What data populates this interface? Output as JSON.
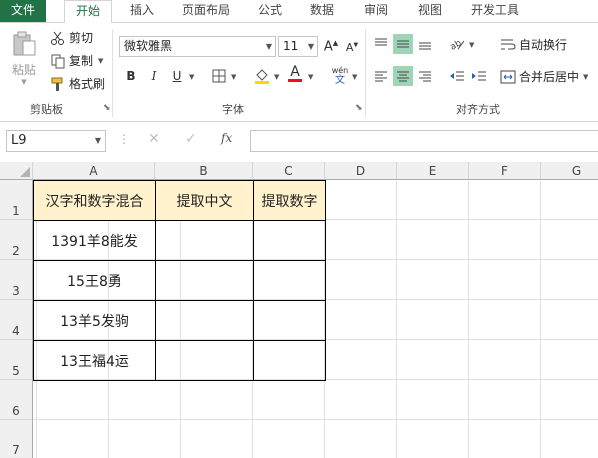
{
  "tabs": [
    "文件",
    "开始",
    "插入",
    "页面布局",
    "公式",
    "数据",
    "审阅",
    "视图",
    "开发工具"
  ],
  "clipboard": {
    "paste_label": "粘贴",
    "cut_label": "剪切",
    "copy_label": "复制",
    "format_painter_label": "格式刷",
    "group_label": "剪贴板"
  },
  "font": {
    "name": "微软雅黑",
    "size": "11",
    "bold": "B",
    "italic": "I",
    "underline": "U",
    "wen_top": "wén",
    "wen_bottom": "文",
    "group_label": "字体",
    "font_color": "#e81123",
    "fill_color": "#ffd700"
  },
  "alignment": {
    "wrap_text_label": "自动换行",
    "merge_center_label": "合并后居中",
    "group_label": "对齐方式"
  },
  "formula_bar": {
    "name_box": "L9",
    "fx": "fx",
    "content": ""
  },
  "columns": [
    "A",
    "B",
    "C",
    "D",
    "E",
    "F",
    "G"
  ],
  "rows": [
    "1",
    "2",
    "3",
    "4",
    "5",
    "6",
    "7"
  ],
  "table": {
    "headers": [
      "汉字和数字混合",
      "提取中文",
      "提取数字"
    ],
    "rows": [
      [
        "1391羊8能发",
        "",
        ""
      ],
      [
        "15王8勇",
        "",
        ""
      ],
      [
        "13羊5发驹",
        "",
        ""
      ],
      [
        "13王福4运",
        "",
        ""
      ]
    ]
  },
  "colors": {
    "accent": "#217346",
    "header_fill": "#fff2cc",
    "align_selected": "#9fd5b7"
  }
}
